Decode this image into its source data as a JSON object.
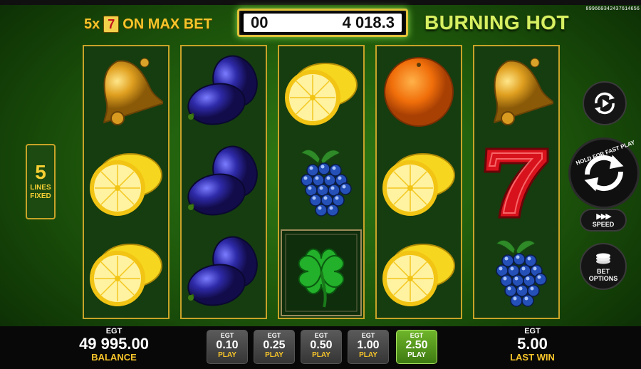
{
  "header": {
    "promo_multiplier": "5x",
    "promo_seven": "7",
    "promo_text": "ON MAX BET",
    "counter_left": "00",
    "counter_value": "4 018.3",
    "game_title": "BURNING HOT",
    "session_id": "899660342437614656"
  },
  "lines": {
    "count": "5",
    "label1": "LINES",
    "label2": "FIXED"
  },
  "reels": [
    [
      "bell",
      "lemon",
      "lemon"
    ],
    [
      "plum",
      "plum",
      "plum"
    ],
    [
      "lemon",
      "grapes",
      "clover"
    ],
    [
      "orange",
      "lemon",
      "lemon"
    ],
    [
      "bell",
      "seven",
      "grapes"
    ]
  ],
  "controls": {
    "autoplay_icon": "autoplay-icon",
    "fast_play_label": "HOLD FOR FAST PLAY",
    "speed_label": "SPEED",
    "bet_options_label1": "BET",
    "bet_options_label2": "OPTIONS"
  },
  "footer": {
    "balance": {
      "brand": "EGT",
      "value": "49 995.00",
      "label": "BALANCE"
    },
    "last_win": {
      "brand": "EGT",
      "value": "5.00",
      "label": "LAST WIN"
    },
    "bets": [
      {
        "brand": "EGT",
        "value": "0.10",
        "label": "PLAY",
        "selected": false
      },
      {
        "brand": "EGT",
        "value": "0.25",
        "label": "PLAY",
        "selected": false
      },
      {
        "brand": "EGT",
        "value": "0.50",
        "label": "PLAY",
        "selected": false
      },
      {
        "brand": "EGT",
        "value": "1.00",
        "label": "PLAY",
        "selected": false
      },
      {
        "brand": "EGT",
        "value": "2.50",
        "label": "PLAY",
        "selected": true
      }
    ]
  },
  "colors": {
    "gold": "#f7c52a",
    "reel_border": "#c8a328",
    "bet_selected": "#4f9a1c",
    "background": "#1f5a0c"
  }
}
